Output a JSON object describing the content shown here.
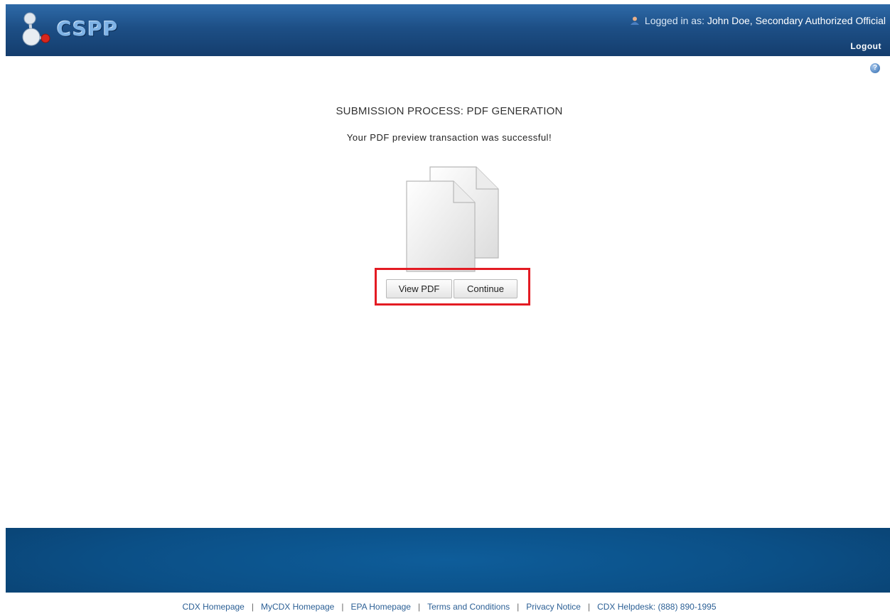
{
  "header": {
    "logo_text": "CSPP",
    "logged_in_prefix": "Logged in as:",
    "user_name": "John Doe, Secondary Authorized Official",
    "logout_label": "Logout"
  },
  "main": {
    "title": "SUBMISSION PROCESS: PDF GENERATION",
    "message": "Your PDF preview transaction was successful!",
    "buttons": {
      "view_pdf": "View PDF",
      "continue": "Continue"
    }
  },
  "footer": {
    "links": [
      "CDX Homepage",
      "MyCDX Homepage",
      "EPA Homepage",
      "Terms and Conditions",
      "Privacy Notice",
      "CDX Helpdesk: (888) 890-1995"
    ]
  },
  "colors": {
    "header": "#1d4f86",
    "footer": "#0b4f86",
    "highlight": "#e31b23",
    "link": "#2b5f95"
  },
  "icons": [
    "molecule-logo-icon",
    "user-icon",
    "help-icon",
    "pdf-documents-icon"
  ]
}
